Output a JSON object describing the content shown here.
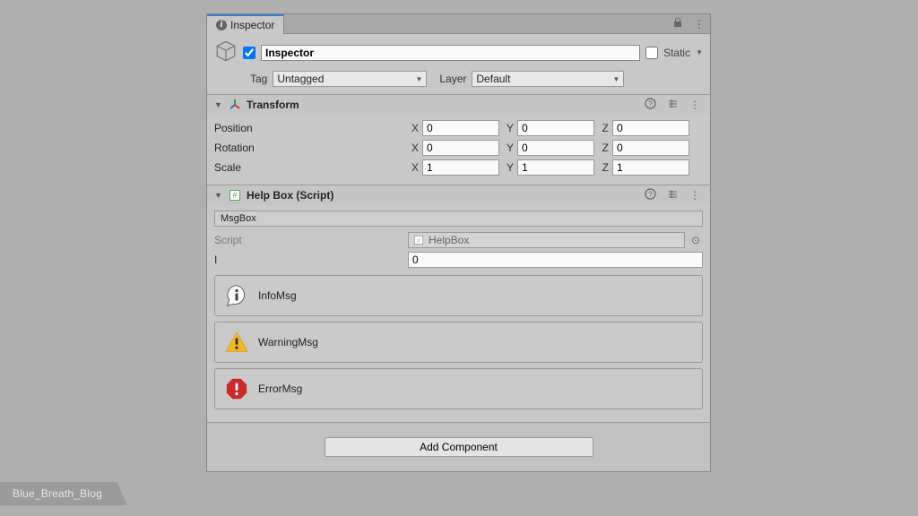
{
  "tab": {
    "title": "Inspector"
  },
  "gameObject": {
    "name": "Inspector",
    "staticLabel": "Static",
    "tagLabel": "Tag",
    "tagValue": "Untagged",
    "layerLabel": "Layer",
    "layerValue": "Default"
  },
  "transform": {
    "title": "Transform",
    "position": {
      "label": "Position",
      "x": "0",
      "y": "0",
      "z": "0"
    },
    "rotation": {
      "label": "Rotation",
      "x": "0",
      "y": "0",
      "z": "0"
    },
    "scale": {
      "label": "Scale",
      "x": "1",
      "y": "1",
      "z": "1"
    }
  },
  "helpBox": {
    "title": "Help Box (Script)",
    "msgBoxLabel": "MsgBox",
    "scriptLabel": "Script",
    "scriptValue": "HelpBox",
    "iLabel": "I",
    "iValue": "0",
    "infoMsg": "InfoMsg",
    "warningMsg": "WarningMsg",
    "errorMsg": "ErrorMsg"
  },
  "addComponent": "Add Component",
  "watermark": "Blue_Breath_Blog",
  "axis": {
    "x": "X",
    "y": "Y",
    "z": "Z"
  }
}
